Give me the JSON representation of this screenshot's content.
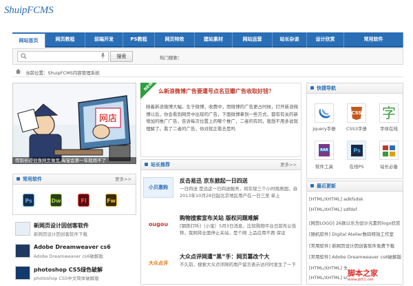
{
  "brand": {
    "logo": "ShuipFCMS"
  },
  "nav": {
    "items": [
      "网站首页",
      "网页教程",
      "前端开发",
      "PS教程",
      "网页特效",
      "建站素材",
      "网站运营",
      "站长杂谈",
      "设计欣赏",
      "常用软件"
    ],
    "active": 0
  },
  "search": {
    "placeholder": "",
    "button": "搜索",
    "hot": "热门搜索："
  },
  "breadcrumb": {
    "text": "当前位置：ShuipFCMS内容管理系统"
  },
  "banner": {
    "caption": "传别长得很像网页做宽 淘宝会第一年就用不了",
    "title_sign": "网店"
  },
  "featured": {
    "badge": "NEW",
    "title": "么新浪微博广告要遭号点名豆瓣广告收取好钱？",
    "desc": "随着新浪微博大幅，生于微博，收费中，而微博的广告更占时候，打开新浪微博以后，你会看到网页中出现的广告，下面微博拿到一些方式，都有有关的新增加的推广广告，告诉每次位置上的哪个推广，二者的有同，我想不用多说就理解了。看了二者的广告，你对就正看去是吗"
  },
  "software": {
    "title": "常用软件",
    "more": "更多>>",
    "icons": [
      "Ps",
      "Dw",
      "Fl",
      "Fw"
    ]
  },
  "articles": [
    {
      "title": "新网页设计因创客软件",
      "desc": "新网页设计因创客软件下载"
    },
    {
      "title": "Adobe Dreamweaver cs6",
      "desc": "Adobe Dreamweaver cs6破解版"
    },
    {
      "title": "photoshop CS5绿色破解",
      "desc": "photoshop CS5中文简体破解版"
    }
  ],
  "recommend": {
    "title": "站长推荐",
    "more": "更多>>",
    "items": [
      {
        "title": "反击易迅 京东掀起一日四送",
        "desc": "一日四送 是迅这一日四送服务，将实现三个小时周质国，自2013年10月28日起北京地区用户在一日三至 单上",
        "thumb": "小贝惠购"
      },
      {
        "title": "购物搜索宣布关站 版权问题难解",
        "desc": "[钢铁打听]（小宝）5月3日消息，比较购物平台日前布公告称，我网将全面停止关站，是个网 上品应用不再 保证",
        "thumb": "ougou"
      },
      {
        "title": "大众点评网遭“黑”手：网页篡改个大",
        "desc": "不久前，搜索大众点评网的用户留言表示访问时发生了一下",
        "thumb": "大众点评"
      }
    ]
  },
  "quick": {
    "title": "快捷导航",
    "items": [
      {
        "label": "jquery手册",
        "icon": "jquery"
      },
      {
        "label": "CSS3手册",
        "icon": "CSS"
      },
      {
        "label": "字体在线",
        "icon": "字"
      },
      {
        "label": "软件工具",
        "icon": "RAR"
      },
      {
        "label": "在线PS",
        "icon": "Ps"
      },
      {
        "label": "站长必备",
        "icon": "tools"
      }
    ]
  },
  "latest": {
    "title": "最近更新",
    "items": [
      "[HTML/XHTML] adkfsdsk",
      "[HTML/XHTML] sdfdsf",
      "[网页LOGO] 26款以乐为设计元素的logo欣赏",
      "[随机软件] Digital Atelier数码特效工作室",
      "[常用软件] 新网页设计因创客软件免费下载",
      "[常用软件] Adobe Dreamweaver cs6破解版",
      "[HTML/XHTML] 头像",
      "[HTML/XHTML] sdfs"
    ]
  },
  "watermark": {
    "text": "脚本之家",
    "url": "www.jb51.net"
  },
  "colors": {
    "primary": "#2a6fb6",
    "featured_title": "#c0392b"
  }
}
